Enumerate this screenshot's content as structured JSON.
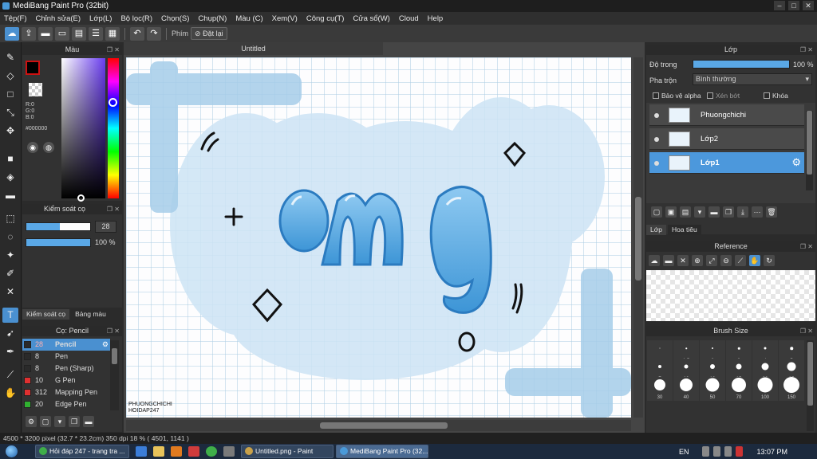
{
  "window": {
    "title": "MediBang Paint Pro (32bit)",
    "controls": [
      "–",
      "□",
      "✕"
    ]
  },
  "menu": [
    "Tệp(F)",
    "Chỉnh sửa(E)",
    "Lớp(L)",
    "Bộ lọc(R)",
    "Chọn(S)",
    "Chụp(N)",
    "Màu (C)",
    "Xem(V)",
    "Công cụ(T)",
    "Cửa sổ(W)",
    "Cloud",
    "Help"
  ],
  "toolbar": {
    "shortcut_label": "Phím",
    "reset_label": "Đặt lại"
  },
  "color_panel": {
    "title": "Màu",
    "rgb": [
      "R:0",
      "G:0",
      "B:0"
    ],
    "hex": "#000000",
    "fg_color": "#000000"
  },
  "brush_control": {
    "title": "Kiểm soát cọ",
    "size": "28",
    "opacity": "100 %"
  },
  "left_tabs": [
    "Kiểm soát cọ",
    "Bảng màu"
  ],
  "brush_panel": {
    "title": "Cọ: Pencil",
    "items": [
      {
        "num": "28",
        "name": "Pencil",
        "color": "#2a2a2a"
      },
      {
        "num": "8",
        "name": "Pen",
        "color": "#2a2a2a"
      },
      {
        "num": "8",
        "name": "Pen (Sharp)",
        "color": "#2a2a2a"
      },
      {
        "num": "10",
        "name": "G Pen",
        "color": "#e03030"
      },
      {
        "num": "312",
        "name": "Mapping Pen",
        "color": "#e03030"
      },
      {
        "num": "20",
        "name": "Edge Pen",
        "color": "#30b030"
      }
    ]
  },
  "canvas": {
    "doc_tab": "Untitled",
    "text": "omg",
    "signature": [
      "PHUONGCHICHI",
      "HOIDAP247"
    ]
  },
  "layer_panel": {
    "title": "Lớp",
    "opacity_label": "Độ trong",
    "opacity_value": "100 %",
    "opacity_fraction": 1.0,
    "blend_label": "Pha trộn",
    "blend_value": "Bình thường",
    "protect_alpha": "Bảo vệ alpha",
    "clipping": "Xén bớt",
    "lock": "Khóa",
    "layers": [
      {
        "name": "Phuongchichi",
        "selected": false
      },
      {
        "name": "Lớp2",
        "selected": false
      },
      {
        "name": "Lớp1",
        "selected": true
      }
    ],
    "tabs": [
      "Lớp",
      "Hoa tiêu"
    ]
  },
  "reference_panel": {
    "title": "Reference"
  },
  "brush_size_panel": {
    "title": "Brush Size",
    "sizes": [
      {
        "label": ".",
        "d": 1
      },
      {
        "label": "1.5",
        "d": 1.5
      },
      {
        "label": "2",
        "d": 2
      },
      {
        "label": "3",
        "d": 2.5
      },
      {
        "label": "4",
        "d": 3
      },
      {
        "label": "5",
        "d": 3.5
      },
      {
        "label": "7",
        "d": 4
      },
      {
        "label": "10",
        "d": 5
      },
      {
        "label": "12",
        "d": 6
      },
      {
        "label": "15",
        "d": 7
      },
      {
        "label": "20",
        "d": 9
      },
      {
        "label": "25",
        "d": 11
      },
      {
        "label": "30",
        "d": 14
      },
      {
        "label": "40",
        "d": 16
      },
      {
        "label": "50",
        "d": 17
      },
      {
        "label": "70",
        "d": 18
      },
      {
        "label": "100",
        "d": 19
      },
      {
        "label": "150",
        "d": 20
      }
    ]
  },
  "status": "4500 * 3200 pixel  (32.7 * 23.2cm)  350 dpi  18 %  ( 4501, 1141 )",
  "taskbar": {
    "items": [
      "Hỏi đáp 247 - trang tra ...",
      "Untitled.png - Paint",
      "MediBang Paint Pro (32..."
    ],
    "lang": "EN",
    "time": "13:07 PM"
  }
}
